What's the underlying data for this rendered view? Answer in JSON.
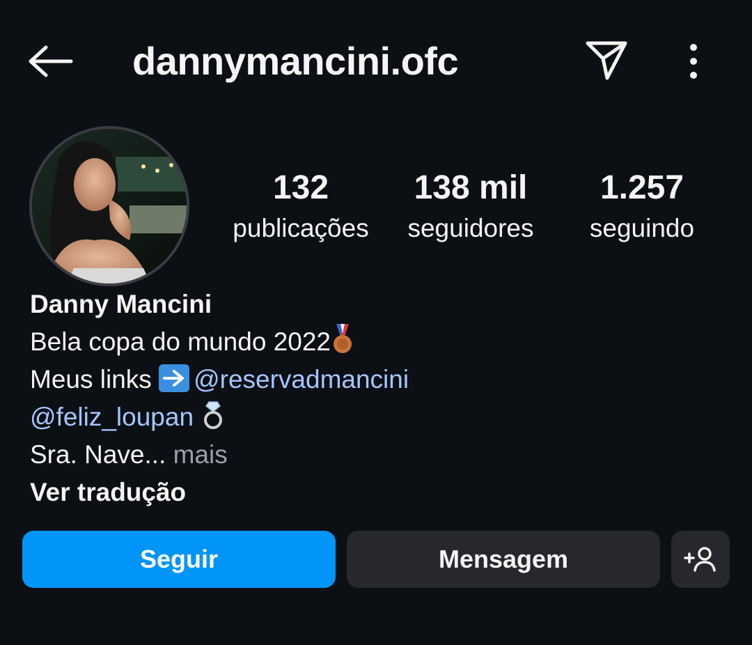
{
  "header": {
    "username": "dannymancini.ofc",
    "back_icon": "arrow-left-icon",
    "share_icon": "paper-plane-icon",
    "more_icon": "more-vertical-icon"
  },
  "profile": {
    "stats": [
      {
        "value": "132",
        "label": "publicações"
      },
      {
        "value": "138 mil",
        "label": "seguidores"
      },
      {
        "value": "1.257",
        "label": "seguindo"
      }
    ]
  },
  "bio": {
    "display_name": "Danny Mancini",
    "line1": "Bela copa do mundo 2022",
    "line2_prefix": "Meus links",
    "mention1": "@reservadmancini",
    "mention2": "@feliz_loupan",
    "line4": "Sra. Nave...",
    "more_label": "mais",
    "translate_label": "Ver tradução"
  },
  "actions": {
    "follow_label": "Seguir",
    "message_label": "Mensagem",
    "suggest_icon": "add-person-icon"
  },
  "colors": {
    "background": "#0c0f14",
    "primary_button": "#0095f6",
    "secondary_button": "#26282d",
    "link": "#a5c7ff",
    "muted": "#9aa0a6"
  }
}
